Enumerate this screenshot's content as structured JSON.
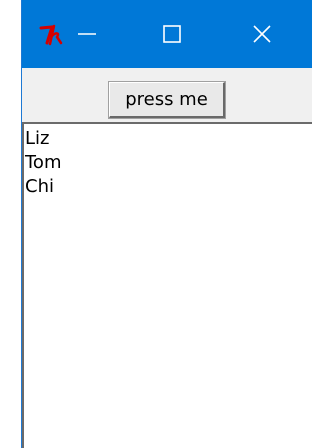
{
  "window": {
    "controls": {
      "minimize_icon": "minimize-icon",
      "maximize_icon": "maximize-icon",
      "close_icon": "close-icon"
    },
    "app_icon": "tk-feather-icon",
    "titlebar_color": "#0078d7"
  },
  "toolbar": {
    "button_label": "press me"
  },
  "listbox": {
    "items": [
      "Liz",
      "Tom",
      "Chi"
    ]
  }
}
